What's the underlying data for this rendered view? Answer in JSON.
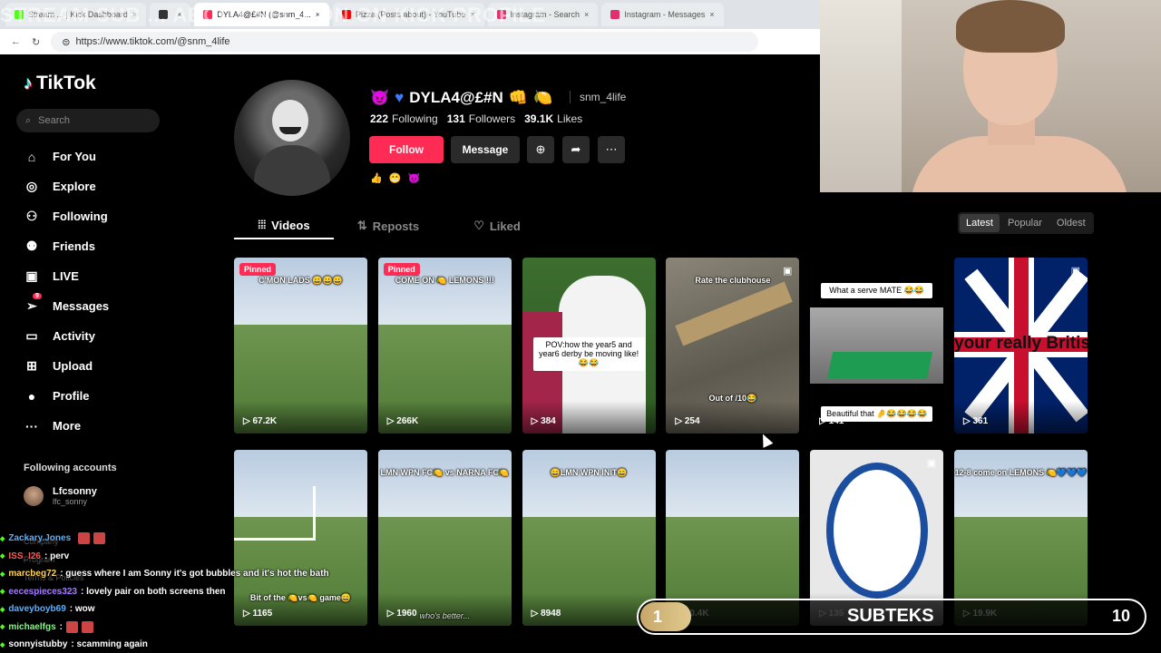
{
  "browser": {
    "tabs": [
      {
        "label": "Stream ... | Kick Dashboard",
        "color": "#53fc18"
      },
      {
        "label": "",
        "color": "#333333"
      },
      {
        "label": "DYLA4@£#N (@snm_4...",
        "color": "#fe2c55"
      },
      {
        "label": "Pizza (Posts about) - YouTube",
        "color": "#ff0000"
      },
      {
        "label": "Instagram - Search",
        "color": "#e1306c"
      },
      {
        "label": "Instagram - Messages",
        "color": "#e1306c"
      }
    ],
    "banner": "STREAM SUB ... ABOUT SECTION ON KICK PROFILE",
    "url": "https://www.tiktok.com/@snm_4life"
  },
  "sidebar": {
    "logo": "TikTok",
    "search_placeholder": "Search",
    "nav": [
      {
        "label": "For You",
        "icon": "home-icon",
        "glyph": "⌂"
      },
      {
        "label": "Explore",
        "icon": "compass-icon",
        "glyph": "◎"
      },
      {
        "label": "Following",
        "icon": "following-icon",
        "glyph": "⚇"
      },
      {
        "label": "Friends",
        "icon": "friends-icon",
        "glyph": "⚉"
      },
      {
        "label": "LIVE",
        "icon": "live-icon",
        "glyph": "▣"
      },
      {
        "label": "Messages",
        "icon": "messages-icon",
        "glyph": "➢",
        "badge": "9"
      },
      {
        "label": "Activity",
        "icon": "activity-icon",
        "glyph": "▭"
      },
      {
        "label": "Upload",
        "icon": "upload-icon",
        "glyph": "⊞"
      },
      {
        "label": "Profile",
        "icon": "profile-icon",
        "glyph": "●"
      },
      {
        "label": "More",
        "icon": "more-icon",
        "glyph": "···"
      }
    ],
    "following_header": "Following accounts",
    "account_name": "Lfcsonny",
    "account_handle": "lfc_sonny",
    "faint_links": [
      "Company",
      "Program",
      "Terms & Policies",
      "© 2025 TikTok"
    ]
  },
  "profile": {
    "display_name": "DYLA4@£#N",
    "username": "snm_4life",
    "following_count": "222",
    "following_label": "Following",
    "followers_count": "131",
    "followers_label": "Followers",
    "likes_count": "39.1K",
    "likes_label": "Likes",
    "follow_label": "Follow",
    "message_label": "Message",
    "bio": "👍 😁 😈"
  },
  "tabs": [
    {
      "label": "Videos",
      "glyph": "⦙⦙⦙",
      "active": true
    },
    {
      "label": "Reposts",
      "glyph": "⇅",
      "active": false
    },
    {
      "label": "Liked",
      "glyph": "♡",
      "active": false
    }
  ],
  "sort": {
    "options": [
      "Latest",
      "Popular",
      "Oldest"
    ],
    "selected": "Latest"
  },
  "videos": [
    {
      "views": "67.2K",
      "pinned": "Pinned",
      "caption": "C'MON LADS 😀😀😀",
      "style": "pitch"
    },
    {
      "views": "266K",
      "pinned": "Pinned",
      "caption": "COME ON 🍋 LEMONS !!!",
      "style": "pitch"
    },
    {
      "views": "384",
      "caption": "POV:how the year5 and year6 derby be moving like!😂😂",
      "style": "player"
    },
    {
      "views": "254",
      "caption": "Rate the clubhouse",
      "caption2": "Out of /10😂",
      "style": "wood"
    },
    {
      "views": "141",
      "caption": "What a serve MATE 😂😂",
      "caption2": "Beautiful that 🤌😂😂😂😂",
      "style": "tabletennis"
    },
    {
      "views": "361",
      "caption": "your really Britis",
      "style": "flag"
    },
    {
      "views": "1165",
      "caption": "Bit of the 🍋vs🍋 game😄",
      "style": "goal"
    },
    {
      "views": "1960",
      "caption": "LMN WPN FC🍋 vs NARNA FC🍋",
      "caption2": "who's better...",
      "style": "pitch"
    },
    {
      "views": "8948",
      "caption": "😄LMN WPN INIT😄",
      "style": "pitch"
    },
    {
      "views": "10.4K",
      "caption": "",
      "style": "pitch"
    },
    {
      "views": "135",
      "caption": "",
      "style": "crest"
    },
    {
      "views": "19.9K",
      "caption": "12-8 come on LEMONS 🍋💙💙💙",
      "style": "pitch"
    }
  ],
  "chat": [
    {
      "user": "Zackary.Jones",
      "msg": "",
      "color": "#5ab0ff",
      "emote": true
    },
    {
      "user": "ISS_I26",
      "msg": ": perv",
      "color": "#ff5a5a"
    },
    {
      "user": "marcbeg72",
      "msg": ": guess where I am Sonny it's got bubbles and it's hot the bath",
      "color": "#ffd45a"
    },
    {
      "user": "eecespieces323",
      "msg": ": lovely pair on both screens then",
      "color": "#a07aff"
    },
    {
      "user": "daveyboyb69",
      "msg": ": wow",
      "color": "#5ab0ff"
    },
    {
      "user": "michaelfgs",
      "msg": ":",
      "color": "#7aff7a",
      "emote": true
    },
    {
      "user": "sonnyistubby",
      "msg": ": scamming again",
      "color": "#ffffff"
    }
  ],
  "subteks": {
    "current": "1",
    "title": "SUBTEKS",
    "goal": "10",
    "progress": 0.1
  }
}
